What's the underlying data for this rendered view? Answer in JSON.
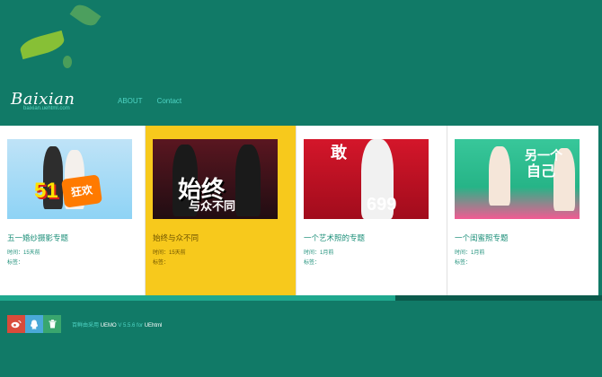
{
  "header": {
    "logo_main": "Baixian",
    "logo_sub": "baixian.uehtml.com",
    "nav": [
      "ABOUT",
      "Contact"
    ]
  },
  "cards": [
    {
      "title": "五一婚纱摄影专题",
      "time": "时间：15天前",
      "tags": "标签：",
      "img_text_a": "51",
      "img_text_b": "狂欢"
    },
    {
      "title": "始终与众不同",
      "time": "时间：15天前",
      "tags": "标签：",
      "img_text_a": "始终",
      "img_text_b": "与众不同"
    },
    {
      "title": "一个艺术照的专题",
      "time": "时间：1月前",
      "tags": "标签：",
      "img_text_a": "敢",
      "img_text_b": "699"
    },
    {
      "title": "一个闺蜜照专题",
      "time": "时间：1月前",
      "tags": "标签：",
      "img_text_a": "另一个",
      "img_text_b": "自己"
    }
  ],
  "progress_fraction": 0.657,
  "footer": {
    "copyright_prefix": "百鲜由采用",
    "copyright_brand": "UEMO",
    "copyright_mid": "V 5.5.6 for",
    "copyright_brand2": "UEhtml"
  },
  "colors": {
    "background": "#117a67",
    "accent": "#4fd5c5",
    "active_card": "#f7c91c"
  },
  "icons": [
    "weibo-icon",
    "qq-icon",
    "trash-icon"
  ]
}
